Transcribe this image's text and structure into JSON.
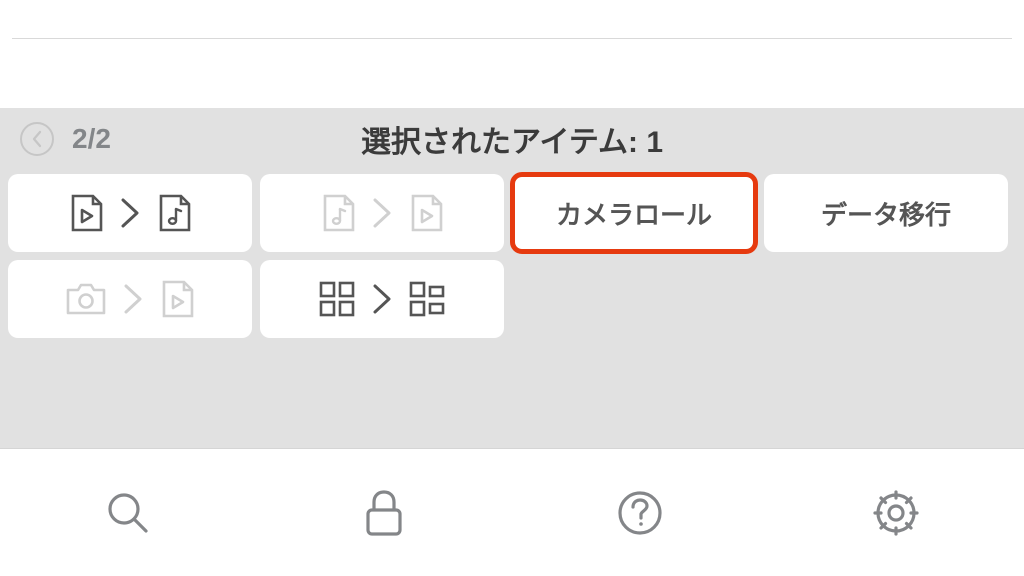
{
  "header": {
    "page_indicator": "2/2",
    "title": "選択されたアイテム: 1"
  },
  "actions": {
    "camera_roll_label": "カメラロール",
    "data_transfer_label": "データ移行"
  },
  "icons": {
    "video_to_music": "video-to-music-icon",
    "music_to_video": "music-to-video-icon",
    "camera_to_video": "camera-to-video-icon",
    "grid_layout": "grid-layout-icon",
    "back": "chevron-left-icon",
    "search": "search-icon",
    "lock": "lock-icon",
    "help": "help-icon",
    "settings": "gear-icon"
  },
  "colors": {
    "background_panel": "#e1e1e1",
    "button_bg": "#ffffff",
    "highlight_border": "#e63a0f",
    "text_muted": "#838689",
    "text_dark": "#3b3b3b",
    "icon_dark": "#555555",
    "icon_light": "#d0d0d0",
    "bottom_icon": "#848689"
  }
}
